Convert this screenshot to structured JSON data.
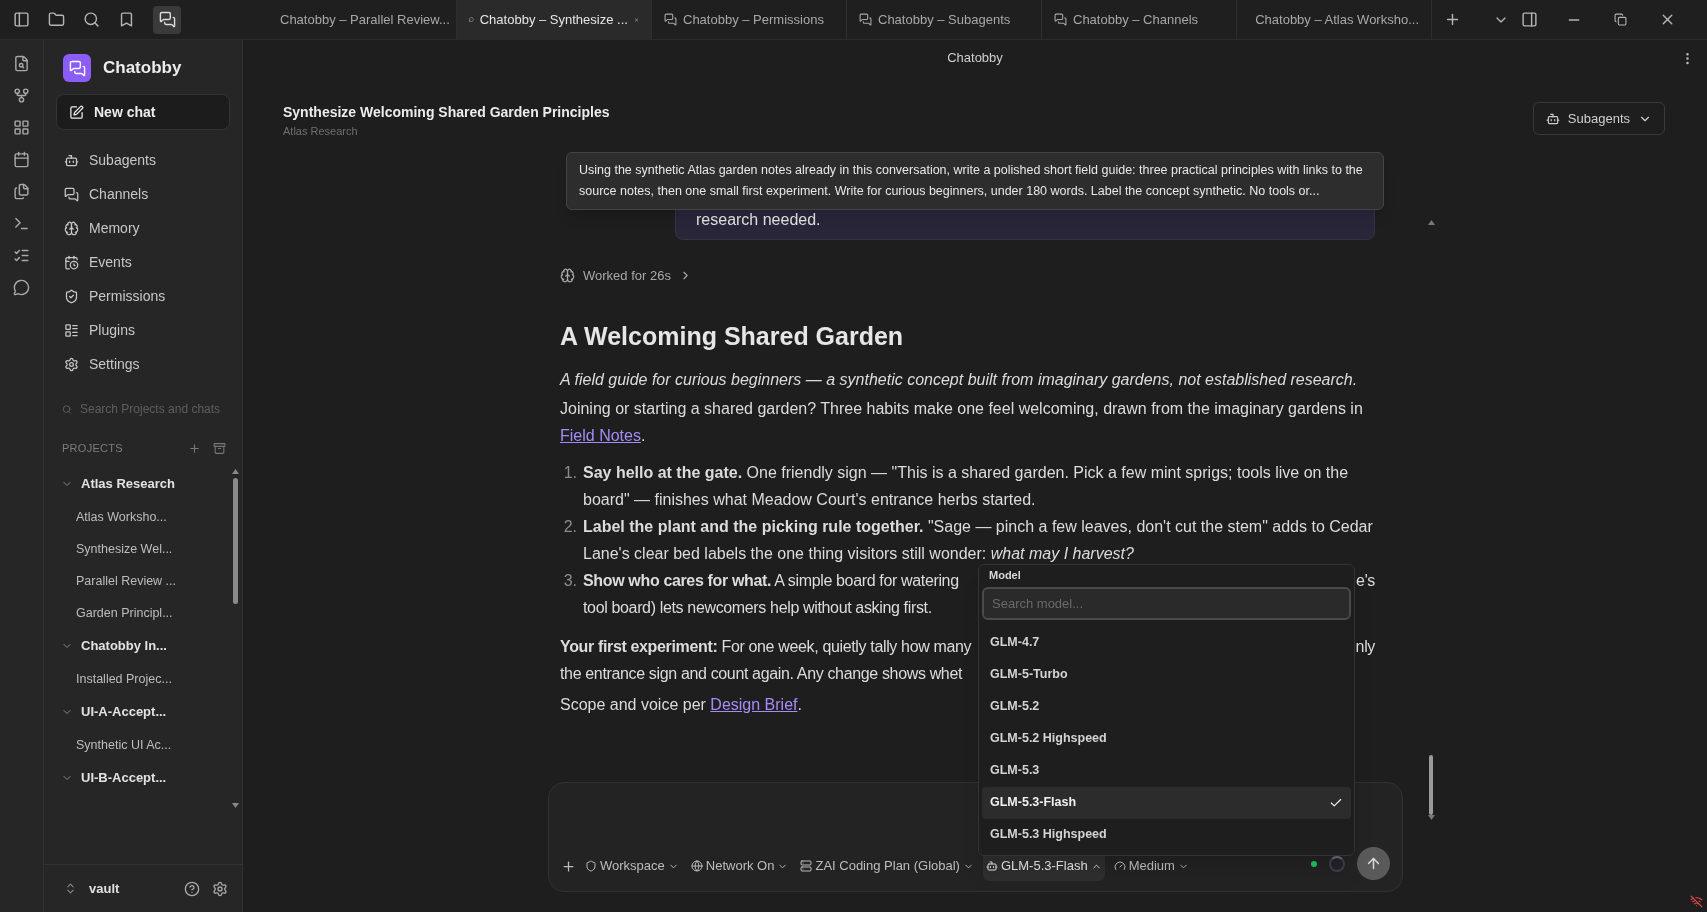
{
  "tabs": [
    {
      "title": "Chatobby – Parallel Review...",
      "selected": false,
      "kind": "chat"
    },
    {
      "title": "Chatobby – Synthesize ...",
      "selected": true,
      "kind": "chat"
    },
    {
      "title": "Chatobby – Permissions",
      "selected": false,
      "kind": "channel"
    },
    {
      "title": "Chatobby – Subagents",
      "selected": false,
      "kind": "channel"
    },
    {
      "title": "Chatobby – Channels",
      "selected": false,
      "kind": "channel"
    },
    {
      "title": "Chatobby – Atlas Worksho...",
      "selected": false,
      "kind": "chat"
    }
  ],
  "window_title": "Chatobby",
  "sidebar": {
    "app_name": "Chatobby",
    "new_chat": "New chat",
    "nav": [
      {
        "label": "Subagents",
        "kind": "bot"
      },
      {
        "label": "Channels",
        "kind": "channels"
      },
      {
        "label": "Memory",
        "kind": "brain"
      },
      {
        "label": "Events",
        "kind": "calendar"
      },
      {
        "label": "Permissions",
        "kind": "shield"
      },
      {
        "label": "Plugins",
        "kind": "plugins"
      },
      {
        "label": "Settings",
        "kind": "settings"
      }
    ],
    "search": {
      "placeholder": "Search Projects and chats"
    },
    "projects_label": "PROJECTS",
    "projects": [
      {
        "name": "Atlas Research",
        "expanded": true,
        "children": [
          {
            "name": "Atlas Worksho..."
          },
          {
            "name": "Synthesize Wel..."
          },
          {
            "name": "Parallel Review ..."
          },
          {
            "name": "Garden Principl..."
          }
        ]
      },
      {
        "name": "Chatobby In...",
        "expanded": true,
        "children": [
          {
            "name": "Installed Projec..."
          }
        ]
      },
      {
        "name": "UI-A-Accept...",
        "expanded": true,
        "children": [
          {
            "name": "Synthetic UI Ac..."
          }
        ]
      },
      {
        "name": "UI-B-Accept...",
        "expanded": true
      }
    ],
    "vault": "vault"
  },
  "header": {
    "title": "Synthesize Welcoming Shared Garden Principles",
    "subtitle": "Atlas Research",
    "subagents_button": "Subagents"
  },
  "tooltip": "Using the synthetic Atlas garden notes already in this conversation, write a polished short field guide: three practical principles with links to the source notes, then one small first experiment. Write for curious beginners, under 180 words. Label the concept synthetic. No tools or...",
  "user_message": "research needed.",
  "worked": "Worked for 26s",
  "answer": {
    "title": "A Welcoming Shared Garden",
    "tagline": "A field guide for curious beginners — a synthetic concept built from imaginary gardens, not established research.",
    "intro": "Joining or starting a shared garden? Three habits make one feel welcoming, drawn from the imaginary gardens in",
    "intro_link": "Field Notes",
    "intro_end": ".",
    "steps": [
      {
        "marker": "1.",
        "kind": "full",
        "text": "**Say hello at the gate.** One friendly sign — \"This is a shared garden. Pick a few mint sprigs; tools live on the board\" — finishes what Meadow Court's entrance herbs started."
      },
      {
        "marker": "2.",
        "kind": "full",
        "text": "**Label the plant and the picking rule together.** \"Sage — pinch a few leaves, don't cut the stem\" adds to Cedar Lane's clear bed labels the one thing visitors still wonder: *what may I harvest?*"
      },
      {
        "marker": "3.",
        "kind": "clipped",
        "lines": [
          {
            "left": "**Show who cares for what.** A simple board for watering",
            "right": "e's"
          },
          {
            "left": "tool board) lets newcomers help without asking first."
          }
        ]
      }
    ],
    "experiment": [
      {
        "left": "**Your first experiment:** For one week, quietly tally how many",
        "right": "nly"
      },
      {
        "left": "the entrance sign and count again. Any change shows whet"
      }
    ],
    "scope": "Scope and voice per",
    "scope_link": "Design Brief",
    "scope_end": "."
  },
  "model_menu": {
    "label": "Model",
    "placeholder": "Search model...",
    "items": [
      {
        "name": "GLM-4.7",
        "selected": false
      },
      {
        "name": "GLM-5-Turbo",
        "selected": false
      },
      {
        "name": "GLM-5.2",
        "selected": false
      },
      {
        "name": "GLM-5.2 Highspeed",
        "selected": false
      },
      {
        "name": "GLM-5.3",
        "selected": false
      },
      {
        "name": "GLM-5.3-Flash",
        "selected": true
      },
      {
        "name": "GLM-5.3 Highspeed",
        "selected": false
      }
    ]
  },
  "composer": {
    "chips": [
      {
        "label": "Workspace",
        "kind": "shield",
        "open": false
      },
      {
        "label": "Network On",
        "kind": "globe",
        "open": false
      },
      {
        "label": "ZAI Coding Plan (Global)",
        "kind": "plan",
        "open": false
      },
      {
        "label": "GLM-5.3-Flash",
        "kind": "model",
        "open": true
      },
      {
        "label": "Medium",
        "kind": "gauge",
        "open": false
      }
    ],
    "connected": true
  }
}
